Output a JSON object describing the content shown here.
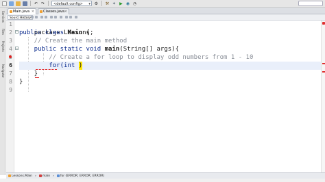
{
  "toolbar": {
    "config": "<default config>",
    "icons": [
      "new-file-icon",
      "new-project-icon",
      "open-project-icon",
      "save-all-icon",
      "undo-icon",
      "redo-icon",
      "build-icon",
      "clean-build-icon",
      "run-icon",
      "debug-icon",
      "profile-icon"
    ]
  },
  "side_panels": [
    "Services",
    "Files",
    "Projects",
    "Navigator"
  ],
  "tabs": [
    {
      "label": "Main.java",
      "active": true
    },
    {
      "label": "Classes.java",
      "active": false
    }
  ],
  "source_bar": {
    "source_label": "Source",
    "history_label": "History"
  },
  "gutter": {
    "lines": [
      "1",
      "2",
      "3",
      "4",
      "5",
      "6",
      "7",
      "8",
      "9"
    ],
    "current_line": "6"
  },
  "code": {
    "l1": "package Lessons;",
    "l2_kw": "public class ",
    "l2_name": "Main",
    "l2_rest": " {",
    "l3": "    // Create the main method",
    "l4_a": "    public static void ",
    "l4_name": "main",
    "l4_rest": "(String[] args){",
    "l5": "        // Create a for loop to display odd numbers from 1 - 10",
    "l6_a": "        for(",
    "l6_kw": "int",
    "l6_rest": " ",
    "l6_caret": ")",
    "l7": "    }",
    "l8": "}",
    "l9": ""
  },
  "breadcrumbs": {
    "class": "Lessons.Main",
    "method": "main",
    "loop": "for (ERROR; ERROR; ERROR)"
  },
  "colors": {
    "keyword": "#0a2a8c",
    "comment": "#8a8f98",
    "caret_highlight": "#ffe600",
    "error": "#e02020",
    "current_line": "#e9effa"
  }
}
